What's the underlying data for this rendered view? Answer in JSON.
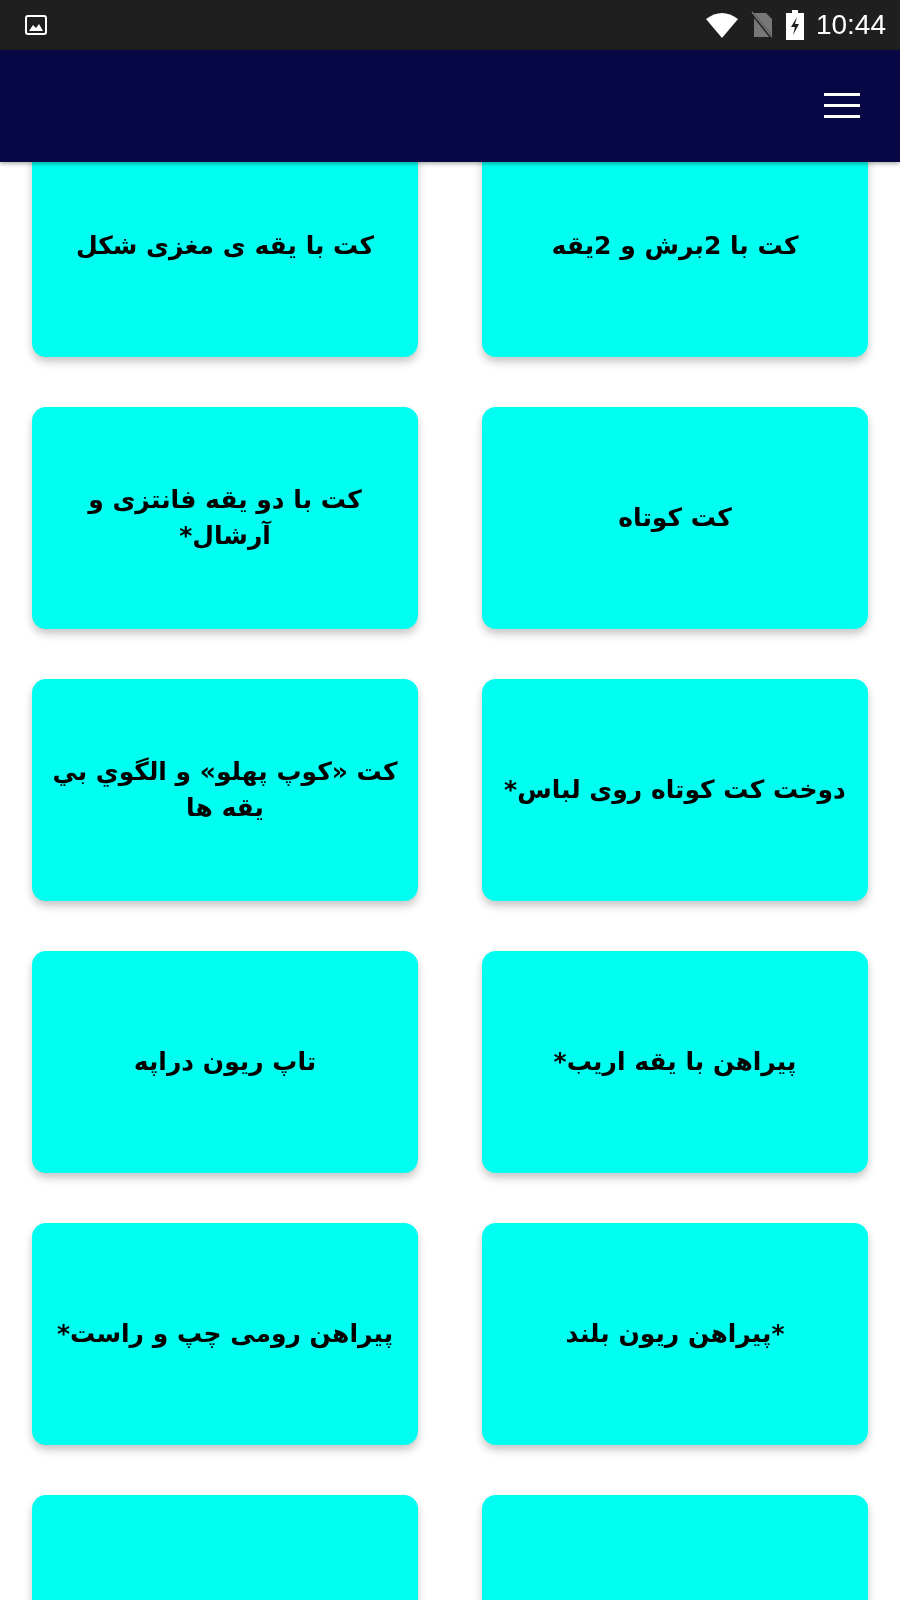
{
  "status_bar": {
    "time": "10:44"
  },
  "rows": [
    {
      "cards": [
        {
          "kind": "full",
          "title": "کت با 2برش و 2یقه"
        },
        {
          "kind": "full",
          "title": "کت با یقه ی مغزی شکل"
        }
      ]
    },
    {
      "cards": [
        {
          "kind": "full",
          "title": "کت کوتاه"
        },
        {
          "kind": "full",
          "title": "کت با دو یقه فانتزی و آرشال*"
        }
      ]
    },
    {
      "cards": [
        {
          "kind": "full",
          "title": "دوخت کت کوتاه روی لباس*"
        },
        {
          "kind": "full",
          "title": "کت «کوپ پهلو» و الگوي بي يقه ها"
        }
      ]
    },
    {
      "cards": [
        {
          "kind": "full",
          "title": "پیراهن با یقه اریب*"
        },
        {
          "kind": "full",
          "title": "تاپ ریون دراپه"
        }
      ]
    },
    {
      "cards": [
        {
          "kind": "full",
          "title": "*پیراهن ریون بلند"
        },
        {
          "kind": "full",
          "title": "پیراهن رومی چپ و راست*"
        }
      ]
    },
    {
      "cards": [
        {
          "kind": "cut"
        },
        {
          "kind": "cut"
        }
      ]
    }
  ]
}
